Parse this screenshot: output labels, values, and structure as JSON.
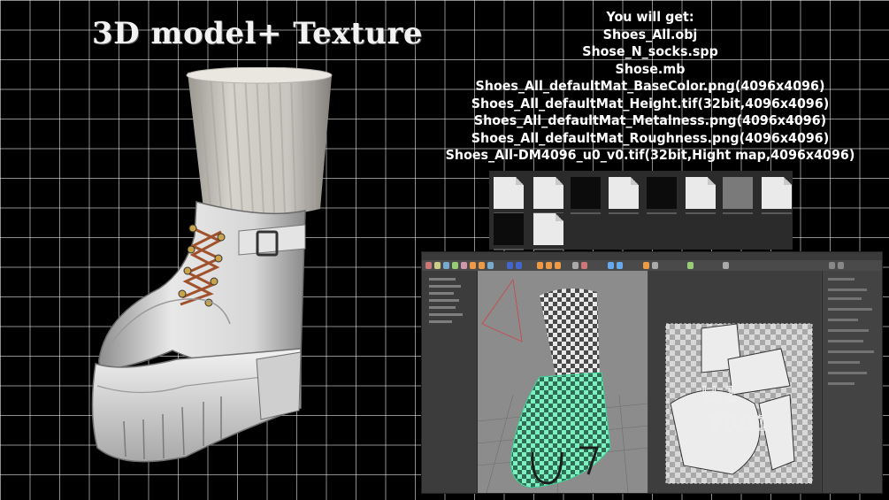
{
  "headline": "3D model+ Texture",
  "deliverables": {
    "heading": "You will get:",
    "files": [
      "Shoes_All.obj",
      "Shose_N_socks.spp",
      "Shose.mb",
      "Shoes_All_defaultMat_BaseColor.png(4096x4096)",
      "Shoes_All_defaultMat_Height.tif(32bit,4096x4096)",
      "Shoes_All_defaultMat_Metalness.png(4096x4096)",
      "Shoes_All_defaultMat_Roughness.png(4096x4096)",
      "Shoes_All-DM4096_u0_v0.tif(32bit,Hight map,4096x4096)"
    ]
  },
  "uv_tile_label": {
    "line1": "U 1",
    "line2": "1001"
  },
  "colors": {
    "background": "#000000",
    "grid": "#ffffff",
    "boot": "#e6e6e6",
    "laces": "#a0522d",
    "uv_highlight": "#5ee6a8"
  },
  "icons": {
    "thumbnails": "file-thumbnail-icon",
    "viewport_object": "boot-model-icon"
  }
}
